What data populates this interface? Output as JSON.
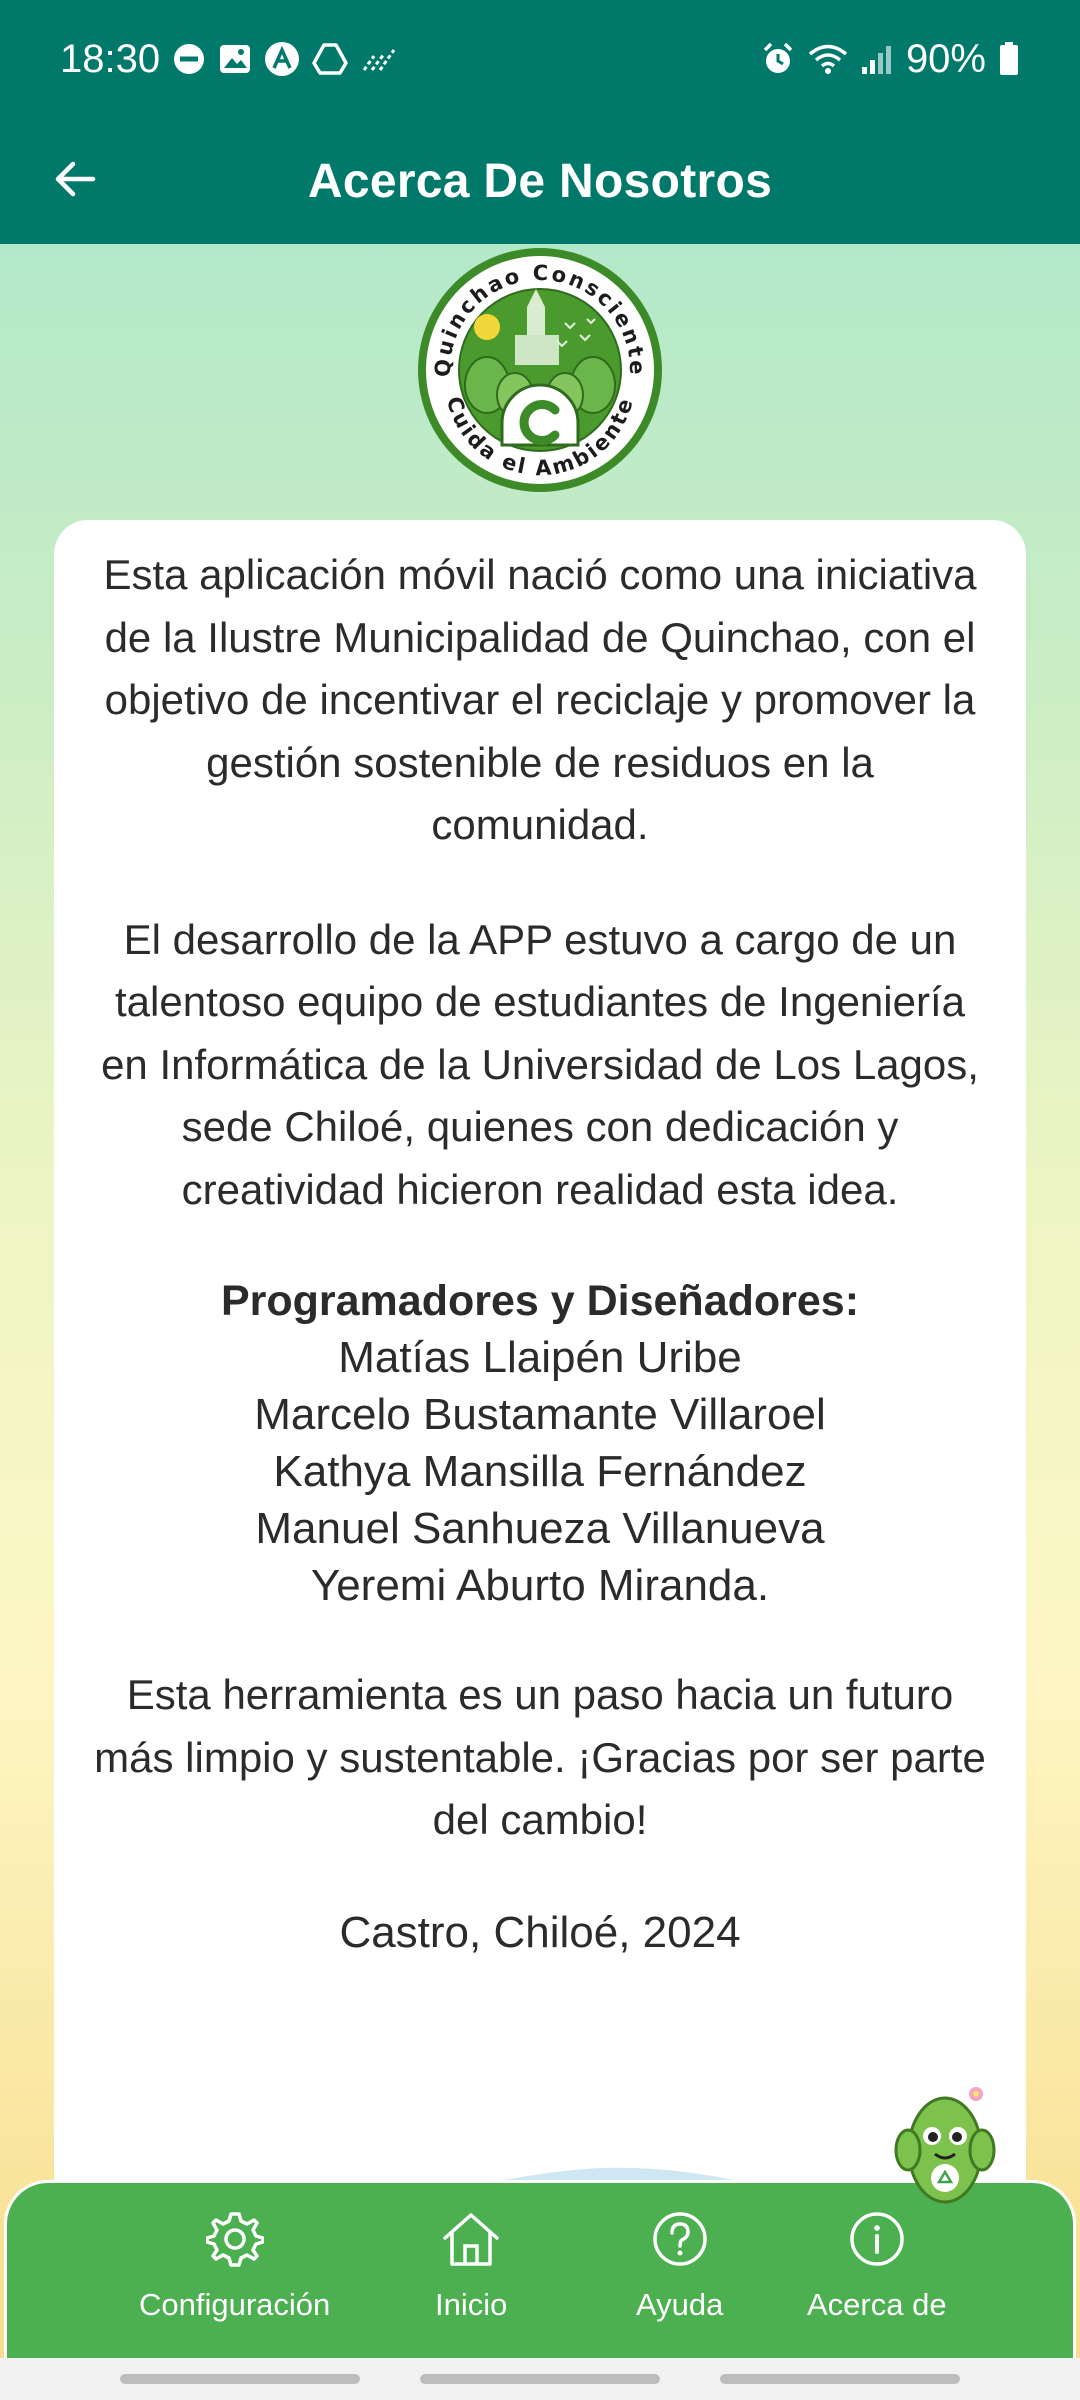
{
  "status_bar": {
    "time": "18:30",
    "battery_percent": "90%",
    "left_icons": [
      "do-not-disturb-icon",
      "image-icon",
      "a-circle-icon",
      "drive-icon",
      "signal-dots-icon"
    ],
    "right_icons": [
      "alarm-icon",
      "wifi-icon",
      "signal-bars-icon",
      "battery-icon"
    ]
  },
  "app_bar": {
    "title": "Acerca De Nosotros",
    "back_icon": "arrow-left-icon"
  },
  "logo": {
    "top_text": "Quinchao Consciente",
    "bottom_text": "Cuida el Ambiente"
  },
  "content": {
    "paragraph_1": "Esta aplicación móvil nació como una iniciativa de la Ilustre Municipalidad de Quinchao, con el objetivo de incentivar el reciclaje y promover la gestión sostenible de residuos en la comunidad.",
    "paragraph_2": "El desarrollo de la APP estuvo a cargo de un talentoso equipo de estudiantes de Ingeniería en Informática de la Universidad de Los Lagos, sede Chiloé, quienes con dedicación y creatividad hicieron realidad esta idea.",
    "team_heading": "Programadores y Diseñadores:",
    "team_members": [
      "Matías Llaipén Uribe",
      "Marcelo Bustamante Villaroel",
      "Kathya Mansilla Fernández",
      "Manuel Sanhueza Villanueva",
      "Yeremi Aburto Miranda."
    ],
    "closing": "Esta herramienta es un paso hacia un futuro más limpio y sustentable. ¡Gracias por ser parte del cambio!",
    "place_year": "Castro, Chiloé, 2024"
  },
  "bottom_nav": [
    {
      "label": "Configuración",
      "icon": "gear-icon"
    },
    {
      "label": "Inicio",
      "icon": "home-icon"
    },
    {
      "label": "Ayuda",
      "icon": "help-circle-icon"
    },
    {
      "label": "Acerca de",
      "icon": "info-circle-icon"
    }
  ],
  "colors": {
    "app_bar": "#00796b",
    "bottom_nav": "#4caf50",
    "logo_green": "#3a8a2a"
  }
}
